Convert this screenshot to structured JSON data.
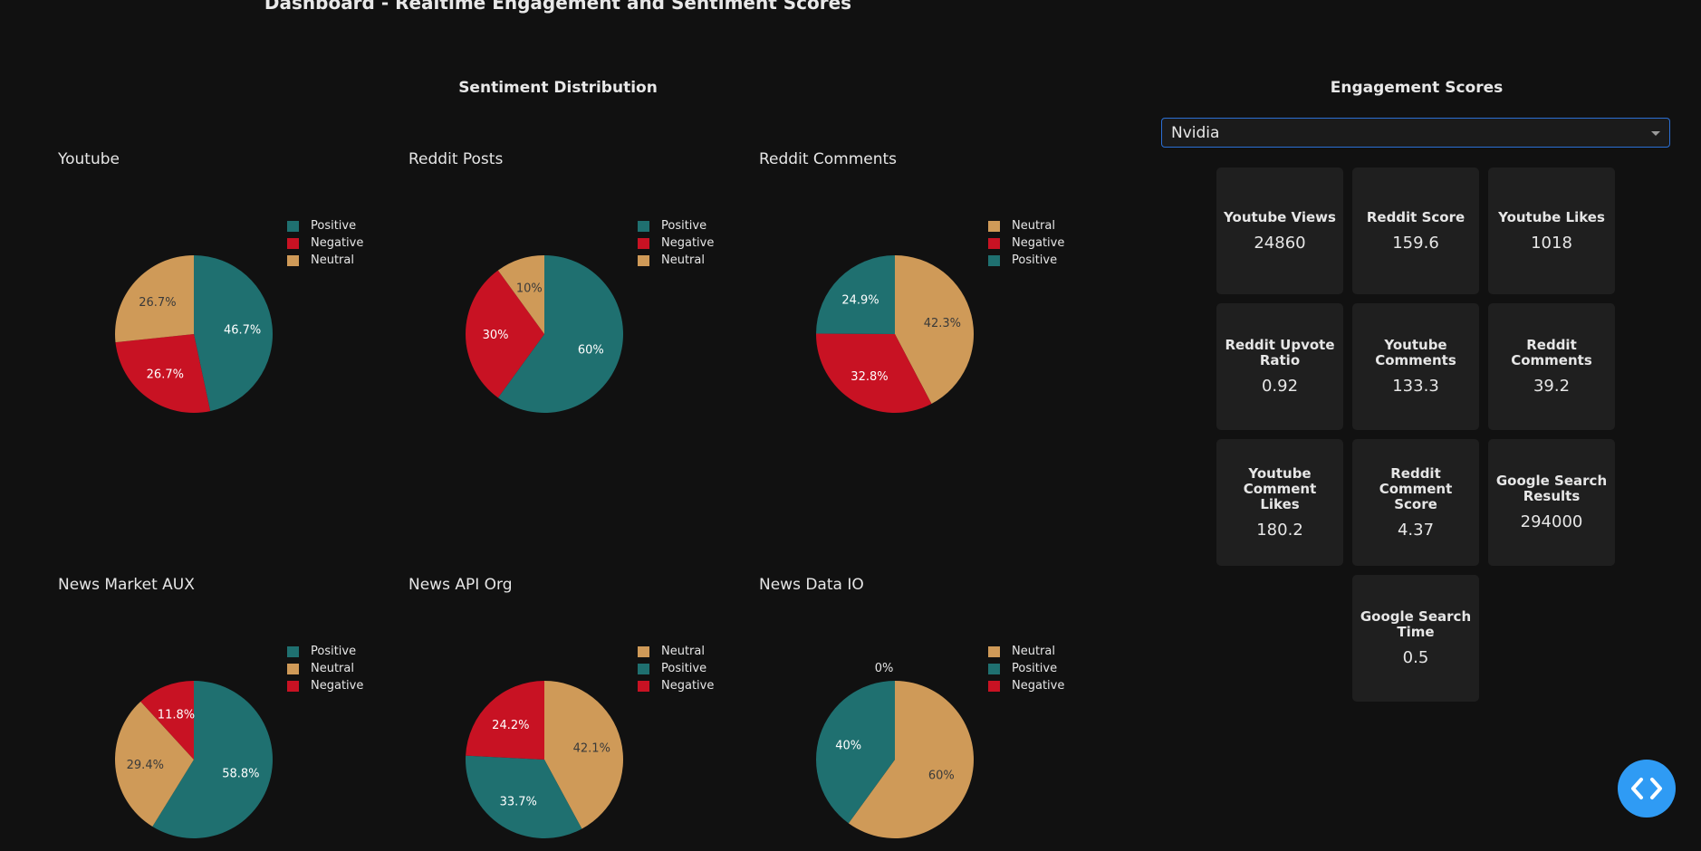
{
  "header": {
    "title": "Dashboard - Realtime Engagement and Sentiment Scores",
    "sentiment_title": "Sentiment Distribution",
    "engagement_title": "Engagement Scores"
  },
  "colors": {
    "Positive": "#1f7070",
    "Negative": "#c81223",
    "Neutral": "#cf9a58",
    "background": "#111111",
    "card": "#1f1f1f",
    "accent": "#2f9bf4"
  },
  "dropdown": {
    "selected": "Nvidia"
  },
  "chart_data": [
    {
      "type": "pie",
      "title": "Youtube",
      "labels": [
        "Positive",
        "Negative",
        "Neutral"
      ],
      "values": [
        46.7,
        26.7,
        26.7
      ],
      "value_labels": [
        "46.7%",
        "26.7%",
        "26.7%"
      ]
    },
    {
      "type": "pie",
      "title": "Reddit Posts",
      "labels": [
        "Positive",
        "Negative",
        "Neutral"
      ],
      "values": [
        60,
        30,
        10
      ],
      "value_labels": [
        "60%",
        "30%",
        "10%"
      ]
    },
    {
      "type": "pie",
      "title": "Reddit Comments",
      "labels": [
        "Neutral",
        "Negative",
        "Positive"
      ],
      "values": [
        42.3,
        32.8,
        24.9
      ],
      "value_labels": [
        "42.3%",
        "32.8%",
        "24.9%"
      ]
    },
    {
      "type": "pie",
      "title": "News Market AUX",
      "labels": [
        "Positive",
        "Neutral",
        "Negative"
      ],
      "values": [
        58.8,
        29.4,
        11.8
      ],
      "value_labels": [
        "58.8%",
        "29.4%",
        "11.8%"
      ]
    },
    {
      "type": "pie",
      "title": "News API Org",
      "labels": [
        "Neutral",
        "Positive",
        "Negative"
      ],
      "values": [
        42.1,
        33.7,
        24.2
      ],
      "value_labels": [
        "42.1%",
        "33.7%",
        "24.2%"
      ]
    },
    {
      "type": "pie",
      "title": "News Data IO",
      "labels": [
        "Neutral",
        "Positive",
        "Negative"
      ],
      "values": [
        60,
        40,
        0
      ],
      "value_labels": [
        "60%",
        "40%",
        "0%"
      ]
    }
  ],
  "engagement": [
    {
      "label": "Youtube Views",
      "value": "24860"
    },
    {
      "label": "Reddit Score",
      "value": "159.6"
    },
    {
      "label": "Youtube Likes",
      "value": "1018"
    },
    {
      "label": "Reddit Upvote Ratio",
      "value": "0.92"
    },
    {
      "label": "Youtube Comments",
      "value": "133.3"
    },
    {
      "label": "Reddit Comments",
      "value": "39.2"
    },
    {
      "label": "Youtube Comment Likes",
      "value": "180.2"
    },
    {
      "label": "Reddit Comment Score",
      "value": "4.37"
    },
    {
      "label": "Google Search Results",
      "value": "294000"
    },
    {
      "label": "Google Search Time",
      "value": "0.5"
    }
  ]
}
